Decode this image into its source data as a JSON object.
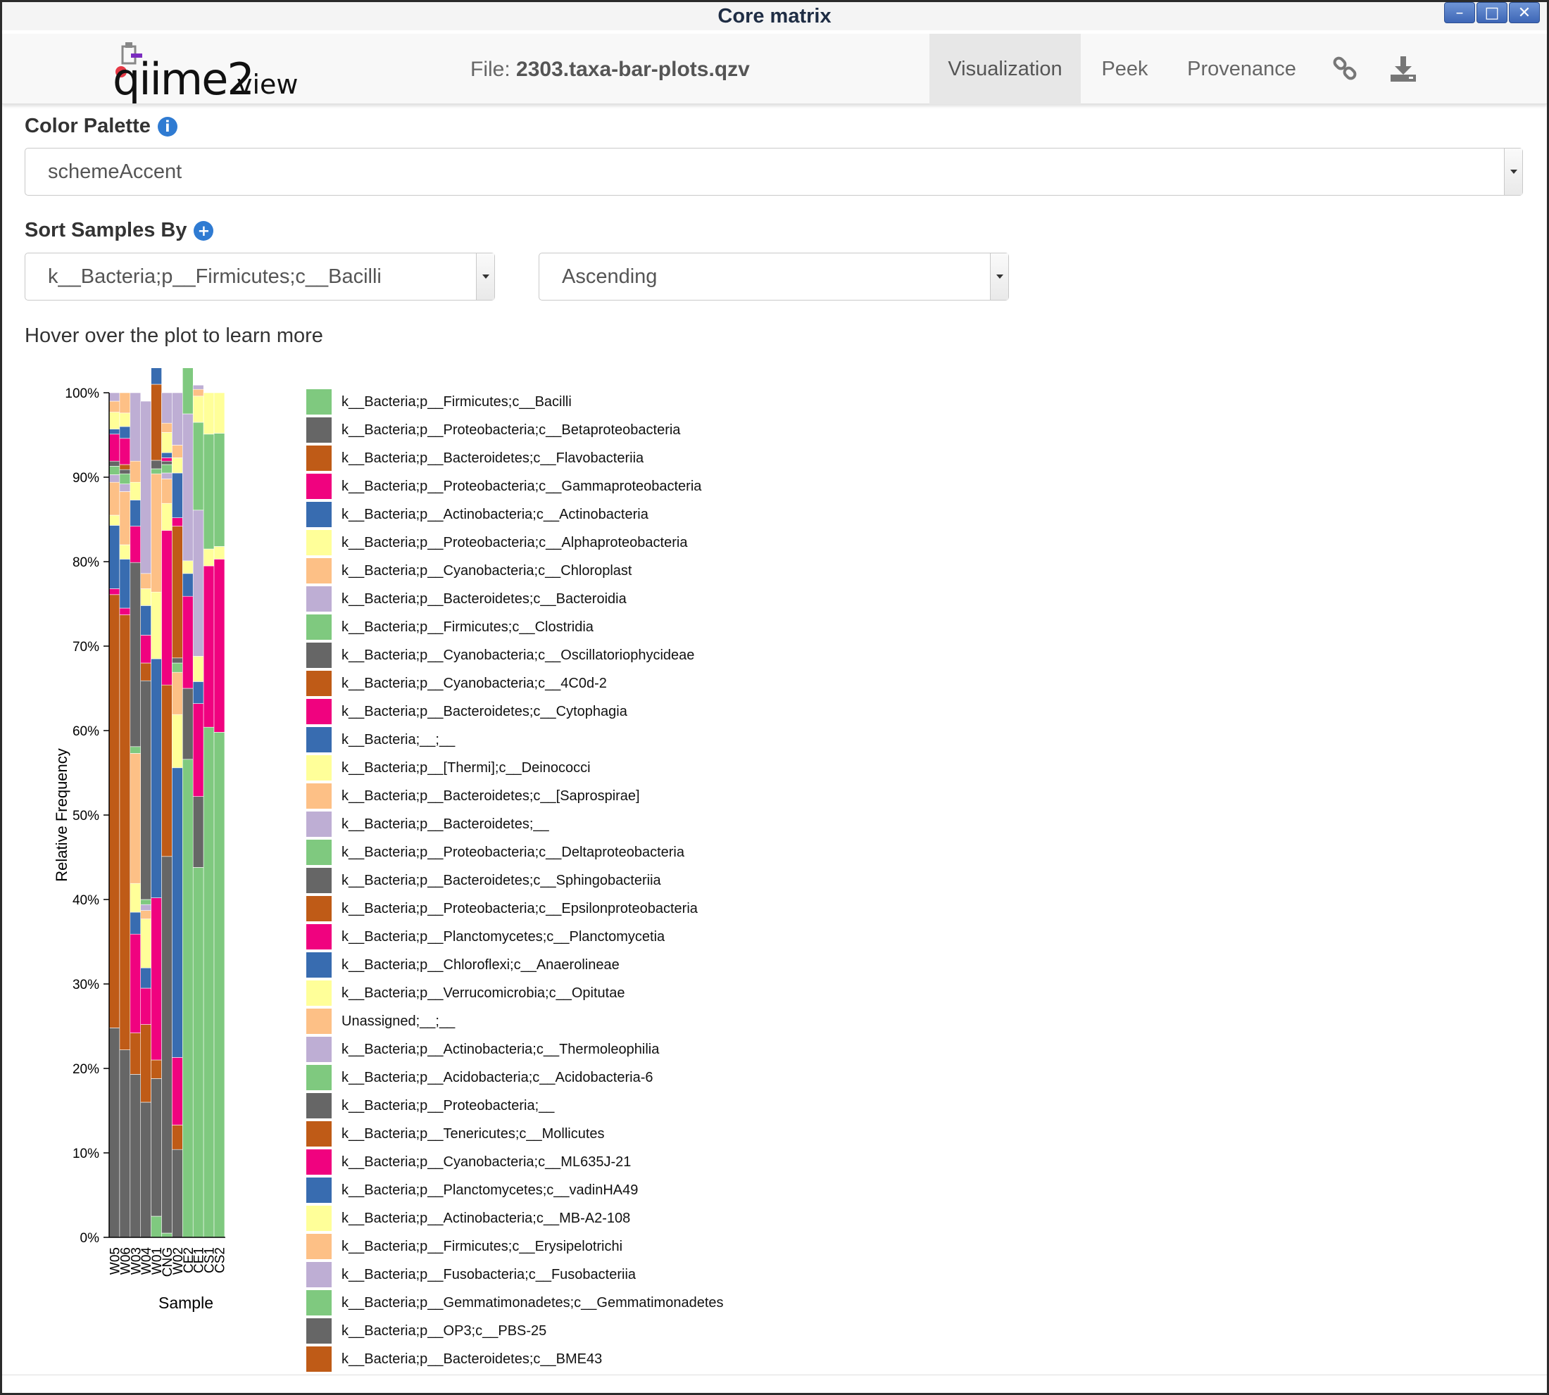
{
  "window": {
    "title": "Core matrix",
    "btn_min": "–",
    "btn_max": "□",
    "btn_close": "✕"
  },
  "navbar": {
    "logo_main": "qiime2",
    "logo_sub": "view",
    "file_prefix": "File: ",
    "file_name": "2303.taxa-bar-plots.qzv",
    "tabs": [
      "Visualization",
      "Peek",
      "Provenance"
    ],
    "active_tab": "Visualization",
    "icons": [
      "link-icon",
      "download-icon"
    ]
  },
  "controls": {
    "color_palette_label": "Color Palette",
    "color_palette_value": "schemeAccent",
    "sort_label": "Sort Samples By",
    "sort_value": "k__Bacteria;p__Firmicutes;c__Bacilli",
    "order_value": "Ascending",
    "hover_hint": "Hover over the plot to learn more"
  },
  "colors": [
    "#7fc97f",
    "#666666",
    "#bf5b17",
    "#f0027f",
    "#386cb0",
    "#ffff99",
    "#fdc086",
    "#beaed4"
  ],
  "chart_data": {
    "type": "bar",
    "stacked": true,
    "xlabel": "Sample",
    "ylabel": "Relative Frequency",
    "ylim": [
      0,
      100
    ],
    "yticks": [
      "0%",
      "10%",
      "20%",
      "30%",
      "40%",
      "50%",
      "60%",
      "70%",
      "80%",
      "90%",
      "100%"
    ],
    "categories": [
      "W05",
      "W06",
      "W03",
      "W04",
      "W01",
      "CNG",
      "W02",
      "CE2",
      "CE1",
      "CS1",
      "CS2"
    ],
    "series": [
      {
        "name": "k__Bacteria;p__Firmicutes;c__Bacilli",
        "values": [
          0,
          0,
          0,
          0,
          2.5,
          0.5,
          0,
          56.6,
          43.8,
          60.4,
          59.8
        ]
      },
      {
        "name": "k__Bacteria;p__Proteobacteria;c__Betaproteobacteria",
        "values": [
          24.8,
          22.2,
          19.3,
          16.0,
          16.3,
          44.6,
          10.4,
          8.4,
          8.4,
          0,
          0
        ]
      },
      {
        "name": "k__Bacteria;p__Bacteroidetes;c__Flavobacteriia",
        "values": [
          51.3,
          51.5,
          4.9,
          9.2,
          2.2,
          20.3,
          2.9,
          0,
          0,
          0,
          0
        ]
      },
      {
        "name": "k__Bacteria;p__Proteobacteria;c__Gammaproteobacteria",
        "values": [
          0.7,
          0.8,
          11.7,
          4.3,
          19.2,
          18.3,
          8.0,
          10.9,
          11.0,
          19.1,
          20.5
        ]
      },
      {
        "name": "k__Bacteria;p__Actinobacteria;c__Actinobacteria",
        "values": [
          7.5,
          5.8,
          2.6,
          2.4,
          28.3,
          0,
          34.3,
          2.7,
          2.6,
          0,
          0
        ]
      },
      {
        "name": "k__Bacteria;p__Proteobacteria;c__Alphaproteobacteria",
        "values": [
          1.2,
          1.7,
          3.4,
          5.8,
          7.9,
          3.2,
          6.3,
          1.5,
          3.0,
          2.0,
          1.5
        ]
      },
      {
        "name": "k__Bacteria;p__Cyanobacteria;c__Chloroplast",
        "values": [
          3.9,
          6.3,
          15.4,
          1.0,
          14.0,
          2.9,
          5.0,
          0,
          0,
          0,
          0
        ]
      },
      {
        "name": "k__Bacteria;p__Bacteroidetes;c__Bacteroidia",
        "values": [
          0.9,
          0.9,
          0,
          0.7,
          0,
          0.7,
          0,
          17.4,
          17.3,
          0,
          0
        ]
      },
      {
        "name": "k__Bacteria;p__Firmicutes;c__Clostridia",
        "values": [
          1.0,
          1.2,
          0.8,
          0.6,
          0.6,
          1.0,
          1.1,
          10.2,
          10.4,
          13.6,
          13.4
        ]
      },
      {
        "name": "k__Bacteria;p__Cyanobacteria;c__Oscillatoriophycideae",
        "values": [
          0.6,
          0.5,
          21.8,
          25.9,
          1.0,
          0.4,
          0.6,
          0,
          0,
          0,
          0
        ]
      },
      {
        "name": "k__Bacteria;p__Cyanobacteria;c__4C0d-2",
        "values": [
          0,
          0.6,
          0,
          2.1,
          9.0,
          0,
          15.6,
          0,
          0,
          0,
          0
        ]
      },
      {
        "name": "k__Bacteria;p__Bacteroidetes;c__Cytophagia",
        "values": [
          3.2,
          3.1,
          4.3,
          3.3,
          0,
          0.4,
          1.0,
          0,
          0,
          0,
          0
        ]
      },
      {
        "name": "k__Bacteria;__;__",
        "values": [
          0.6,
          1.4,
          3.1,
          3.5,
          2.1,
          0.6,
          5.3,
          0,
          0,
          0,
          0
        ]
      },
      {
        "name": "k__Bacteria;p__[Thermi];c__Deinococci",
        "values": [
          2.0,
          1.6,
          2.1,
          2.0,
          1.9,
          2.4,
          1.8,
          2.9,
          3.1,
          4.9,
          4.8
        ]
      },
      {
        "name": "k__Bacteria;p__Bacteroidetes;c__[Saprospirae]",
        "values": [
          1.3,
          2.4,
          2.5,
          1.8,
          1.2,
          1.1,
          1.5,
          0.8,
          0.8,
          0,
          0
        ]
      },
      {
        "name": "k__Bacteria;p__Bacteroidetes;__",
        "values": [
          1.0,
          0,
          8.1,
          20.4,
          0,
          3.6,
          6.2,
          0.5,
          0.5,
          0,
          0
        ]
      }
    ],
    "legend": {
      "placement": "right",
      "entries": [
        "k__Bacteria;p__Firmicutes;c__Bacilli",
        "k__Bacteria;p__Proteobacteria;c__Betaproteobacteria",
        "k__Bacteria;p__Bacteroidetes;c__Flavobacteriia",
        "k__Bacteria;p__Proteobacteria;c__Gammaproteobacteria",
        "k__Bacteria;p__Actinobacteria;c__Actinobacteria",
        "k__Bacteria;p__Proteobacteria;c__Alphaproteobacteria",
        "k__Bacteria;p__Cyanobacteria;c__Chloroplast",
        "k__Bacteria;p__Bacteroidetes;c__Bacteroidia",
        "k__Bacteria;p__Firmicutes;c__Clostridia",
        "k__Bacteria;p__Cyanobacteria;c__Oscillatoriophycideae",
        "k__Bacteria;p__Cyanobacteria;c__4C0d-2",
        "k__Bacteria;p__Bacteroidetes;c__Cytophagia",
        "k__Bacteria;__;__",
        "k__Bacteria;p__[Thermi];c__Deinococci",
        "k__Bacteria;p__Bacteroidetes;c__[Saprospirae]",
        "k__Bacteria;p__Bacteroidetes;__",
        "k__Bacteria;p__Proteobacteria;c__Deltaproteobacteria",
        "k__Bacteria;p__Bacteroidetes;c__Sphingobacteriia",
        "k__Bacteria;p__Proteobacteria;c__Epsilonproteobacteria",
        "k__Bacteria;p__Planctomycetes;c__Planctomycetia",
        "k__Bacteria;p__Chloroflexi;c__Anaerolineae",
        "k__Bacteria;p__Verrucomicrobia;c__Opitutae",
        "Unassigned;__;__",
        "k__Bacteria;p__Actinobacteria;c__Thermoleophilia",
        "k__Bacteria;p__Acidobacteria;c__Acidobacteria-6",
        "k__Bacteria;p__Proteobacteria;__",
        "k__Bacteria;p__Tenericutes;c__Mollicutes",
        "k__Bacteria;p__Cyanobacteria;c__ML635J-21",
        "k__Bacteria;p__Planctomycetes;c__vadinHA49",
        "k__Bacteria;p__Actinobacteria;c__MB-A2-108",
        "k__Bacteria;p__Firmicutes;c__Erysipelotrichi",
        "k__Bacteria;p__Fusobacteria;c__Fusobacteriia",
        "k__Bacteria;p__Gemmatimonadetes;c__Gemmatimonadetes",
        "k__Bacteria;p__OP3;c__PBS-25",
        "k__Bacteria;p__Bacteroidetes;c__BME43"
      ]
    }
  }
}
